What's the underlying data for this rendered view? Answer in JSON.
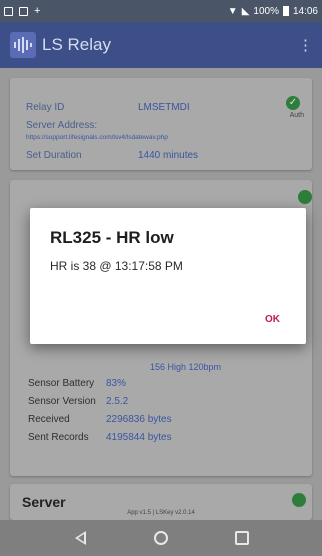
{
  "status_bar": {
    "battery": "100%",
    "time": "14:06"
  },
  "app_bar": {
    "title": "LS Relay",
    "menu_icon": "overflow-vertical-icon"
  },
  "relay_card": {
    "relay_id_label": "Relay ID",
    "relay_id_value": "LMSETMDI",
    "server_address_label": "Server Address:",
    "server_address_value": "https://support.lifesignals.com/lsv4/lsdatewav.php",
    "auth_label": "Auth",
    "set_duration_label": "Set Duration",
    "set_duration_value": "1440 minutes"
  },
  "device_card": {
    "hr_partial": "156 High  120bpm",
    "rows": [
      {
        "key": "Sensor Battery",
        "value": "83%"
      },
      {
        "key": "Sensor Version",
        "value": "2.5.2"
      },
      {
        "key": "Received",
        "value": "2296836 bytes"
      },
      {
        "key": "Sent Records",
        "value": "4195844 bytes"
      }
    ]
  },
  "server_card": {
    "title": "Server",
    "version_text": "App v1.5  |  LSKey v2.0.14"
  },
  "dialog": {
    "title": "RL325 - HR low",
    "message": "HR is 38 @ 13:17:58 PM",
    "ok_label": "OK"
  },
  "colors": {
    "app_bar": "#3c4f88",
    "status_ok": "#2f7d3a",
    "dialog_button": "#c2185b"
  }
}
